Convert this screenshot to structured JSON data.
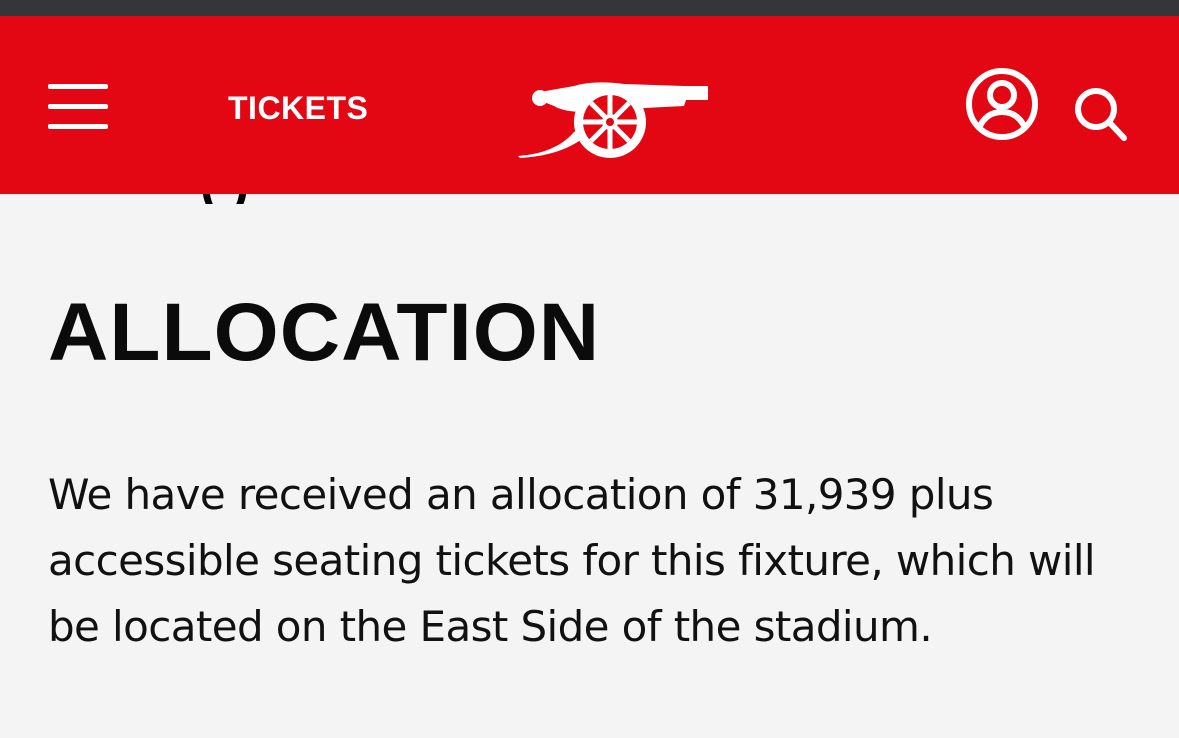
{
  "header": {
    "menu_icon": "hamburger-menu-icon",
    "tickets_label": "TICKETS",
    "logo_icon": "cannon-logo-icon",
    "account_icon": "user-account-icon",
    "search_icon": "search-icon",
    "brand_color": "#e30613"
  },
  "content": {
    "heading": "ALLOCATION",
    "paragraph": "We have received an allocation of 31,939 plus accessible seating tickets for this fixture, which will be located on the East Side of the stadium."
  }
}
